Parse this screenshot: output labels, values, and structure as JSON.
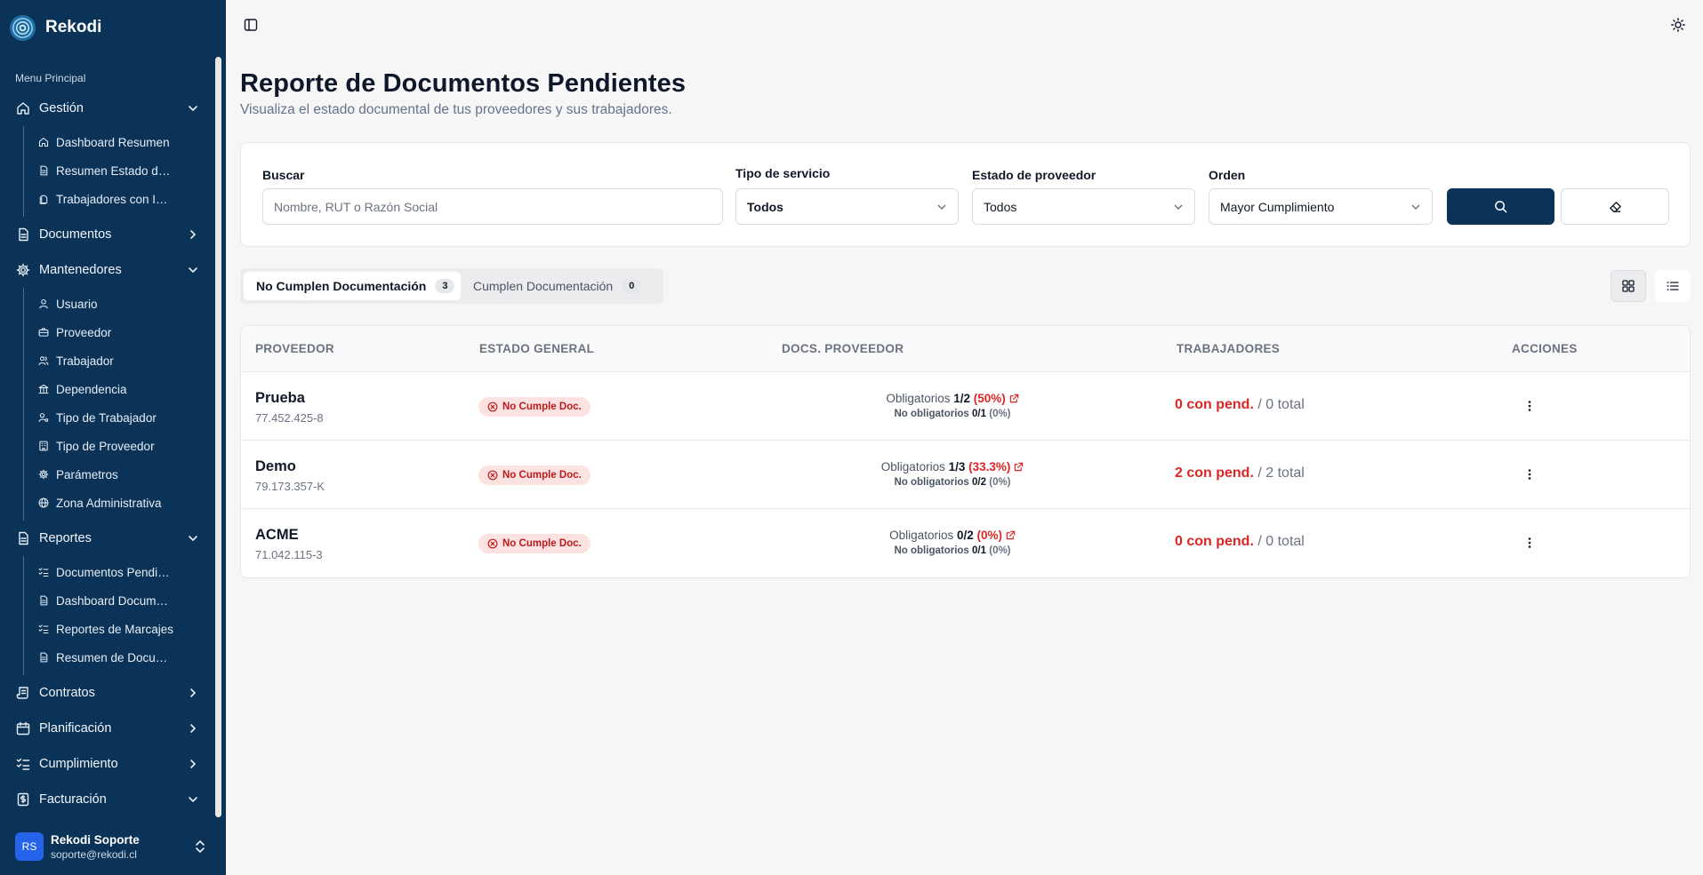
{
  "app": {
    "name": "Rekodi"
  },
  "colors": {
    "sidebar_bg": "#0b3358",
    "accent_red": "#dc2626",
    "primary": "#0b3358"
  },
  "sidebar": {
    "menu_title": "Menu Principal",
    "groups": [
      {
        "label": "Gestión",
        "icon": "home-icon",
        "expanded": true,
        "items": [
          {
            "label": "Dashboard Resumen",
            "icon": "home-icon"
          },
          {
            "label": "Resumen Estado d…",
            "icon": "file-icon"
          },
          {
            "label": "Trabajadores con I…",
            "icon": "files-icon"
          }
        ]
      },
      {
        "label": "Documentos",
        "icon": "file-icon",
        "expanded": false,
        "items": []
      },
      {
        "label": "Mantenedores",
        "icon": "gear-icon",
        "expanded": true,
        "items": [
          {
            "label": "Usuario",
            "icon": "user-icon"
          },
          {
            "label": "Proveedor",
            "icon": "briefcase-icon"
          },
          {
            "label": "Trabajador",
            "icon": "users-icon"
          },
          {
            "label": "Dependencia",
            "icon": "landmark-icon"
          },
          {
            "label": "Tipo de Trabajador",
            "icon": "user-cog-icon"
          },
          {
            "label": "Tipo de Proveedor",
            "icon": "building-icon"
          },
          {
            "label": "Parámetros",
            "icon": "gear-icon"
          },
          {
            "label": "Zona Administrativa",
            "icon": "globe-icon"
          }
        ]
      },
      {
        "label": "Reportes",
        "icon": "file-icon",
        "expanded": true,
        "items": [
          {
            "label": "Documentos Pendi…",
            "icon": "list-checks-icon"
          },
          {
            "label": "Dashboard Docum…",
            "icon": "file-icon"
          },
          {
            "label": "Reportes de Marcajes",
            "icon": "list-checks-icon"
          },
          {
            "label": "Resumen de Docu…",
            "icon": "file-icon"
          }
        ]
      },
      {
        "label": "Contratos",
        "icon": "scroll-icon",
        "expanded": false,
        "items": []
      },
      {
        "label": "Planificación",
        "icon": "calendar-icon",
        "expanded": false,
        "items": []
      },
      {
        "label": "Cumplimiento",
        "icon": "list-checks-icon",
        "expanded": false,
        "items": []
      },
      {
        "label": "Facturación",
        "icon": "receipt-icon",
        "expanded": true,
        "items": []
      }
    ],
    "user": {
      "initials": "RS",
      "name": "Rekodi Soporte",
      "email": "soporte@rekodi.cl"
    }
  },
  "page": {
    "title": "Reporte de Documentos Pendientes",
    "subtitle": "Visualiza el estado documental de tus proveedores y sus trabajadores."
  },
  "filters": {
    "search_label": "Buscar",
    "search_placeholder": "Nombre, RUT o Razón Social",
    "service_label": "Tipo de servicio",
    "service_value": "Todos",
    "provider_status_label": "Estado de proveedor",
    "provider_status_value": "Todos",
    "order_label": "Orden",
    "order_value": "Mayor Cumplimiento"
  },
  "tabs": [
    {
      "label": "No Cumplen Documentación",
      "count": "3",
      "active": true
    },
    {
      "label": "Cumplen Documentación",
      "count": "0",
      "active": false
    }
  ],
  "table": {
    "headers": [
      "PROVEEDOR",
      "ESTADO GENERAL",
      "DOCS. PROVEEDOR",
      "TRABAJADORES",
      "ACCIONES"
    ],
    "rows": [
      {
        "name": "Prueba",
        "rut": "77.452.425-8",
        "status": "No Cumple Doc.",
        "oblig_label": "Obligatorios",
        "oblig_ratio": "1/2",
        "oblig_pct": "(50%)",
        "nooblig_label": "No obligatorios",
        "nooblig_ratio": "0/1",
        "nooblig_pct": "(0%)",
        "pend": "0 con pend.",
        "total": "/ 0 total"
      },
      {
        "name": "Demo",
        "rut": "79.173.357-K",
        "status": "No Cumple Doc.",
        "oblig_label": "Obligatorios",
        "oblig_ratio": "1/3",
        "oblig_pct": "(33.3%)",
        "nooblig_label": "No obligatorios",
        "nooblig_ratio": "0/2",
        "nooblig_pct": "(0%)",
        "pend": "2 con pend.",
        "total": "/ 2 total"
      },
      {
        "name": "ACME",
        "rut": "71.042.115-3",
        "status": "No Cumple Doc.",
        "oblig_label": "Obligatorios",
        "oblig_ratio": "0/2",
        "oblig_pct": "(0%)",
        "nooblig_label": "No obligatorios",
        "nooblig_ratio": "0/1",
        "nooblig_pct": "(0%)",
        "pend": "0 con pend.",
        "total": "/ 0 total"
      }
    ]
  }
}
